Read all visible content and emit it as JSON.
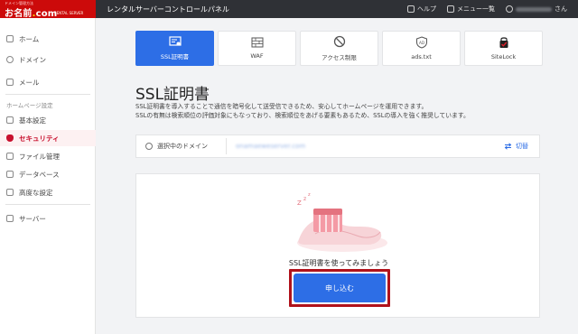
{
  "brand": {
    "top": "ドメイン管理方法",
    "name": "お名前",
    "dot": ".",
    "suffix": "com",
    "sub": "RENTAL SERVER"
  },
  "topbar": {
    "title": "レンタルサーバーコントロールパネル",
    "help": "ヘルプ",
    "menu": "メニュー一覧",
    "user_suffix": "さん"
  },
  "sidebar": {
    "items": [
      {
        "label": "ホーム",
        "icon": "home-icon"
      },
      {
        "label": "ドメイン",
        "icon": "globe-icon"
      },
      {
        "label": "メール",
        "icon": "mail-icon"
      }
    ],
    "section": "ホームページ設定",
    "sub_items": [
      {
        "label": "基本設定",
        "icon": "monitor-icon"
      },
      {
        "label": "セキュリティ",
        "icon": "shield-icon",
        "active": true
      },
      {
        "label": "ファイル管理",
        "icon": "file-icon"
      },
      {
        "label": "データベース",
        "icon": "database-icon"
      },
      {
        "label": "高度な設定",
        "icon": "settings-icon"
      }
    ],
    "server": {
      "label": "サーバー",
      "icon": "server-icon"
    }
  },
  "tabs": [
    {
      "label": "SSL証明書",
      "icon": "certificate-icon",
      "active": true
    },
    {
      "label": "WAF",
      "icon": "firewall-icon"
    },
    {
      "label": "アクセス制限",
      "icon": "block-icon"
    },
    {
      "label": "ads.txt",
      "icon": "ad-shield-icon"
    },
    {
      "label": "SiteLock",
      "icon": "sitelock-icon"
    }
  ],
  "main": {
    "title": "SSL証明書",
    "desc1": "SSL証明書を導入することで通信を暗号化して送受信できるため、安心してホームページを運用できます。",
    "desc2": "SSLの有無は検索順位の評価対象にもなっており、検索順位をあげる要素もあるため、SSLの導入を強く推奨しています。",
    "domain_label": "選択中のドメイン",
    "domain_value": "onamaeweserver.com",
    "switch_label": "切替",
    "card_text": "SSL証明書を使ってみましょう",
    "apply_label": "申し込む"
  },
  "colors": {
    "accent": "#2d6ee6",
    "brand": "#cc0a0a",
    "highlight": "#b0121b"
  }
}
